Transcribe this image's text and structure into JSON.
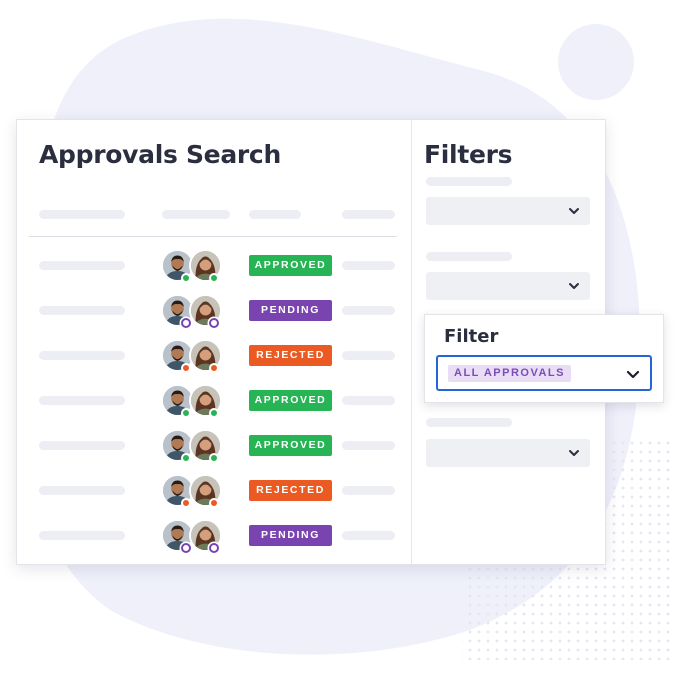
{
  "app": {
    "title": "Approvals Search"
  },
  "filters_panel": {
    "title": "Filters",
    "dropdown_icon": "chevron-down-icon"
  },
  "filter_popover": {
    "label": "Filter",
    "selected_value": "ALL APPROVALS",
    "dropdown_icon": "chevron-down-icon"
  },
  "status_colors": {
    "approved": "#27b454",
    "pending": "#7a44b0",
    "rejected": "#eb5a22"
  },
  "rows": [
    {
      "status": "APPROVED",
      "status_key": "approved"
    },
    {
      "status": "PENDING",
      "status_key": "pending"
    },
    {
      "status": "REJECTED",
      "status_key": "rejected"
    },
    {
      "status": "APPROVED",
      "status_key": "approved"
    },
    {
      "status": "APPROVED",
      "status_key": "approved"
    },
    {
      "status": "REJECTED",
      "status_key": "rejected"
    },
    {
      "status": "PENDING",
      "status_key": "pending"
    }
  ],
  "colors": {
    "accent_blue": "#2466d8",
    "background_blob": "#eff0fa",
    "title_text": "#2b2e3f"
  }
}
